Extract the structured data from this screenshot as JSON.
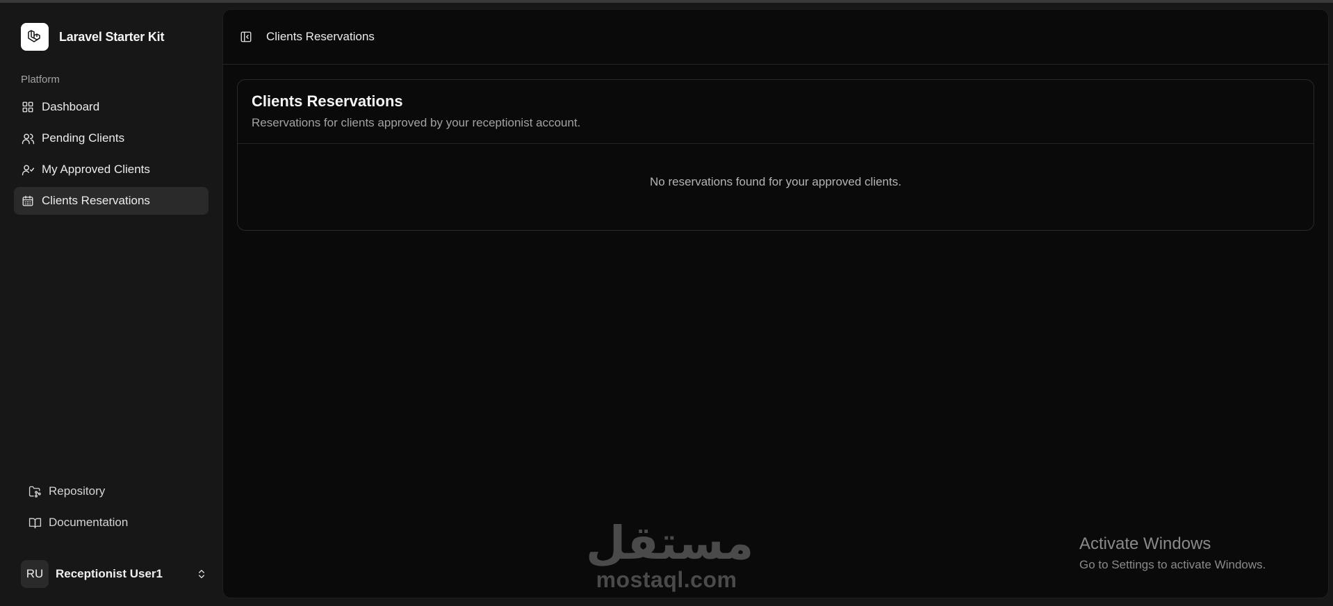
{
  "app": {
    "name": "Laravel Starter Kit"
  },
  "sidebar": {
    "group_label": "Platform",
    "items": [
      {
        "label": "Dashboard",
        "icon": "layout-grid-icon",
        "active": false
      },
      {
        "label": "Pending Clients",
        "icon": "users-icon",
        "active": false
      },
      {
        "label": "My Approved Clients",
        "icon": "user-check-icon",
        "active": false
      },
      {
        "label": "Clients Reservations",
        "icon": "calendar-icon",
        "active": true
      }
    ],
    "footer_links": [
      {
        "label": "Repository",
        "icon": "folder-git-icon"
      },
      {
        "label": "Documentation",
        "icon": "book-open-icon"
      }
    ],
    "user": {
      "initials": "RU",
      "name": "Receptionist User1"
    }
  },
  "header": {
    "breadcrumb": "Clients Reservations"
  },
  "card": {
    "title": "Clients Reservations",
    "description": "Reservations for clients approved by your receptionist account.",
    "empty_message": "No reservations found for your approved clients."
  },
  "overlay": {
    "watermark_arabic": "مستقل",
    "watermark_latin": "mostaql.com",
    "activate_title": "Activate Windows",
    "activate_subtitle": "Go to Settings to activate Windows."
  },
  "colors": {
    "background": "#171717",
    "panel": "#0a0a0a",
    "active_item": "#2a2a2a",
    "text": "#ececec",
    "muted": "#a3a3a3"
  }
}
